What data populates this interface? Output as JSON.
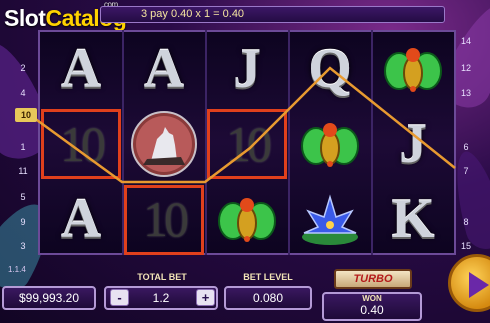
{
  "logo": {
    "slot": "Slot",
    "catalog": "Catalog",
    "com": "com"
  },
  "win_banner": {
    "text": "3  pay 0.40 x 1 = 0.40"
  },
  "paylines": {
    "left": [
      "2",
      "4",
      "10",
      "1",
      "11",
      "5",
      "9",
      "3"
    ],
    "right": [
      "14",
      "12",
      "13",
      "6",
      "7",
      "8",
      "15"
    ],
    "active_line": "10"
  },
  "reels": {
    "row1": [
      "A",
      "A",
      "J",
      "Q",
      "scarab"
    ],
    "row2": [
      "10",
      "wolf",
      "10",
      "scarab",
      "J"
    ],
    "row3": [
      "A",
      "10",
      "scarab",
      "water-lily",
      "K"
    ]
  },
  "balance": {
    "value": "$99,993.20"
  },
  "total_bet": {
    "label": "TOTAL BET",
    "value": "1.2",
    "minus": "-",
    "plus": "+"
  },
  "bet_level": {
    "label": "BET LEVEL",
    "value": "0.080"
  },
  "turbo": {
    "label": "TURBO"
  },
  "won": {
    "label": "WON",
    "value": "0.40"
  },
  "version": "1.1.4",
  "colors": {
    "highlight": "#e0401c",
    "payline": "#e89a30",
    "accent": "#ffd200"
  }
}
